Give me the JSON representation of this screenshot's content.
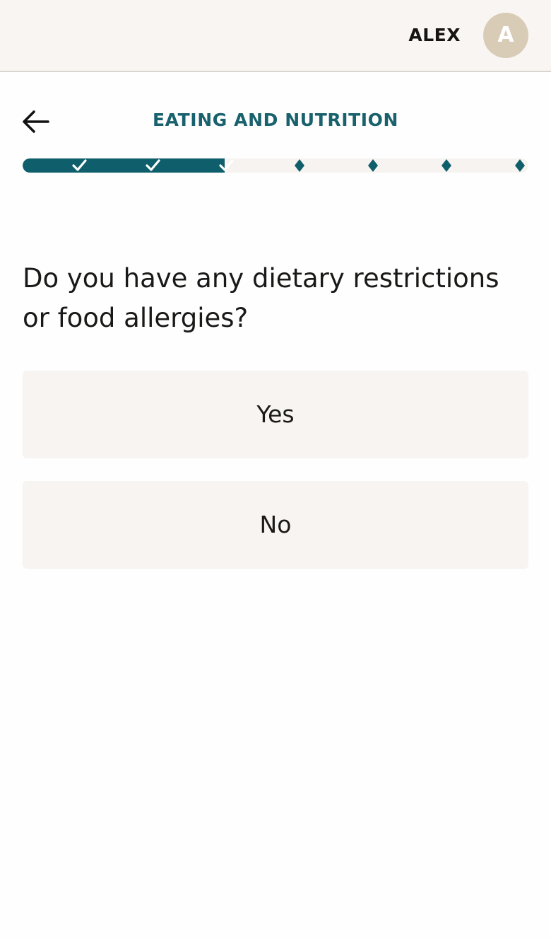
{
  "header": {
    "username": "ALEX",
    "avatar_initial": "A"
  },
  "nav": {
    "back_icon": "arrow-left-icon",
    "section_title": "EATING AND NUTRITION"
  },
  "progress": {
    "total_steps": 7,
    "completed_steps": 3,
    "completed_fraction": 0.4,
    "completed_marker_icon": "checkmark-icon",
    "pending_marker_icon": "diamond-icon",
    "fill_color": "#0e5f6b",
    "track_color": "#f7f3f0"
  },
  "question": {
    "text": "Do you have any dietary restrictions or food allergies?"
  },
  "options": [
    {
      "label": "Yes"
    },
    {
      "label": "No"
    }
  ],
  "colors": {
    "accent": "#19616d",
    "avatar_bg": "#d9ccb6",
    "header_bg": "#f8f5f2",
    "option_bg": "#f7f4f1"
  }
}
